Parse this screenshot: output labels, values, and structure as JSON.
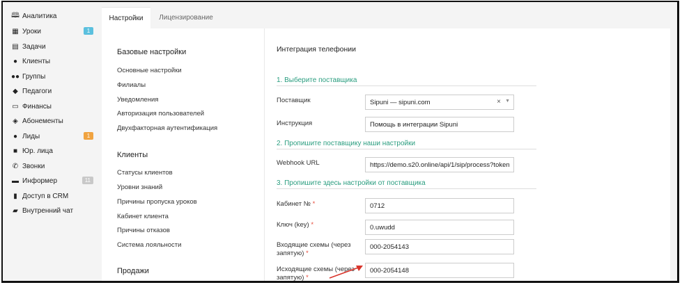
{
  "sidebar": {
    "items": [
      {
        "label": "Аналитика",
        "icon": "map-icon",
        "glyph": "🕮"
      },
      {
        "label": "Уроки",
        "icon": "calendar-icon",
        "glyph": "▦",
        "badge": "1",
        "badge_color": "#5bc0de"
      },
      {
        "label": "Задачи",
        "icon": "clipboard-icon",
        "glyph": "▤"
      },
      {
        "label": "Клиенты",
        "icon": "user-icon",
        "glyph": "●"
      },
      {
        "label": "Группы",
        "icon": "users-icon",
        "glyph": "●●"
      },
      {
        "label": "Педагоги",
        "icon": "graduation-cap-icon",
        "glyph": "◆"
      },
      {
        "label": "Финансы",
        "icon": "money-icon",
        "glyph": "▭"
      },
      {
        "label": "Абонементы",
        "icon": "tag-icon",
        "glyph": "◈"
      },
      {
        "label": "Лиды",
        "icon": "user-plus-icon",
        "glyph": "●",
        "badge": "1",
        "badge_color": "#f0a340"
      },
      {
        "label": "Юр. лица",
        "icon": "briefcase-icon",
        "glyph": "■"
      },
      {
        "label": "Звонки",
        "icon": "phone-icon",
        "glyph": "✆"
      },
      {
        "label": "Информер",
        "icon": "inbox-icon",
        "glyph": "▬",
        "badge": "11",
        "badge_color": "#c8c8c8"
      },
      {
        "label": "Доступ в CRM",
        "icon": "lock-icon",
        "glyph": "▮"
      },
      {
        "label": "Внутренний чат",
        "icon": "chat-icon",
        "glyph": "▰"
      }
    ]
  },
  "tabs": {
    "settings": "Настройки",
    "licensing": "Лицензирование"
  },
  "settings_menu": {
    "basic": {
      "title": "Базовые настройки",
      "links": [
        "Основные настройки",
        "Филиалы",
        "Уведомления",
        "Авторизация пользователей",
        "Двухфакторная аутентификация"
      ]
    },
    "clients": {
      "title": "Клиенты",
      "links": [
        "Статусы клиентов",
        "Уровни знаний",
        "Причины пропуска уроков",
        "Кабинет клиента",
        "Причины отказов",
        "Система лояльности"
      ]
    },
    "sales": {
      "title": "Продажи"
    }
  },
  "integration": {
    "title": "Интеграция телефонии",
    "step1": "1. Выберите поставщика",
    "provider_label": "Поставщик",
    "provider_value": "Sipuni — sipuni.com",
    "clear_glyph": "×",
    "caret_glyph": "▼",
    "instruction_label": "Инструкция",
    "instruction_value": "Помощь в интеграции Sipuni",
    "step2": "2. Пропишите поставщику наши настройки",
    "webhook_label": "Webhook URL",
    "webhook_value": "https://demo.s20.online/api/1/sip/process?token",
    "step3": "3. Пропишите здесь настройки от поставщика",
    "cabinet_label": "Кабинет №",
    "cabinet_value": "0712",
    "key_label": "Ключ (key)",
    "key_value": "0.uwudd",
    "incoming_label": "Входящие схемы (через запятую)",
    "incoming_value": "000-2054143",
    "outgoing_label": "Исходящие схемы (через запятую)",
    "outgoing_value": "000-2054148",
    "required_mark": "*"
  },
  "colors": {
    "accent": "#2a9d7f",
    "required": "#e74c3c",
    "arrow": "#d9342b"
  }
}
